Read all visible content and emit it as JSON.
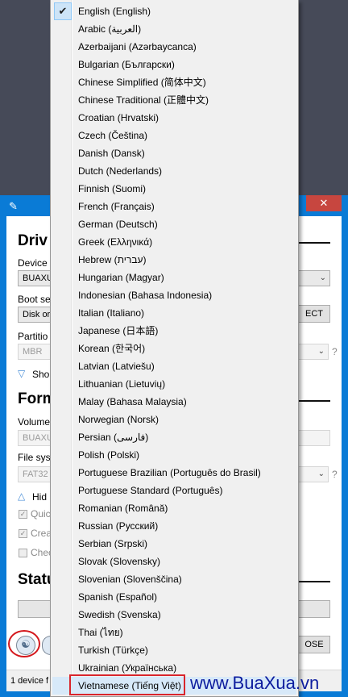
{
  "app": {
    "close_glyph": "✕",
    "drive_section_title": "Driv",
    "device_label": "Device",
    "device_value": "BUAXU",
    "boot_label": "Boot se",
    "boot_value": "Disk or",
    "select_button": "ECT",
    "partition_label": "Partitio",
    "partition_value": "MBR",
    "help_mark": "?",
    "show_advanced": "Sho",
    "format_section_title": "Form",
    "volume_label": "Volume",
    "volume_value": "BUAXU",
    "filesystem_label": "File syst",
    "filesystem_value": "FAT32",
    "hide_advanced": "Hid",
    "quick_format": "Quic",
    "create_extended": "Crea",
    "check_bad_blocks": "Chec",
    "status_section_title": "Statu",
    "close_button": "OSE",
    "status_text": "1 device f"
  },
  "menu": {
    "items": [
      {
        "label": "English (English)",
        "checked": true
      },
      {
        "label": "Arabic (العربية)"
      },
      {
        "label": "Azerbaijani (Azərbaycanca)"
      },
      {
        "label": "Bulgarian (Български)"
      },
      {
        "label": "Chinese Simplified (简体中文)"
      },
      {
        "label": "Chinese Traditional (正體中文)"
      },
      {
        "label": "Croatian (Hrvatski)"
      },
      {
        "label": "Czech (Čeština)"
      },
      {
        "label": "Danish (Dansk)"
      },
      {
        "label": "Dutch (Nederlands)"
      },
      {
        "label": "Finnish (Suomi)"
      },
      {
        "label": "French (Français)"
      },
      {
        "label": "German (Deutsch)"
      },
      {
        "label": "Greek (Ελληνικά)"
      },
      {
        "label": "Hebrew (עברית)"
      },
      {
        "label": "Hungarian (Magyar)"
      },
      {
        "label": "Indonesian (Bahasa Indonesia)"
      },
      {
        "label": "Italian (Italiano)"
      },
      {
        "label": "Japanese (日本語)"
      },
      {
        "label": "Korean (한국어)"
      },
      {
        "label": "Latvian (Latviešu)"
      },
      {
        "label": "Lithuanian (Lietuvių)"
      },
      {
        "label": "Malay (Bahasa Malaysia)"
      },
      {
        "label": "Norwegian (Norsk)"
      },
      {
        "label": "Persian (فارسی)"
      },
      {
        "label": "Polish (Polski)"
      },
      {
        "label": "Portuguese Brazilian (Português do Brasil)"
      },
      {
        "label": "Portuguese Standard (Português)"
      },
      {
        "label": "Romanian (Română)"
      },
      {
        "label": "Russian (Русский)"
      },
      {
        "label": "Serbian (Srpski)"
      },
      {
        "label": "Slovak (Slovensky)"
      },
      {
        "label": "Slovenian (Slovenščina)"
      },
      {
        "label": "Spanish (Español)"
      },
      {
        "label": "Swedish (Svenska)"
      },
      {
        "label": "Thai (ไทย)"
      },
      {
        "label": "Turkish (Türkçe)"
      },
      {
        "label": "Ukrainian (Українська)"
      },
      {
        "label": "Vietnamese (Tiếng Việt)",
        "highlighted": true
      }
    ]
  },
  "watermark": "www.BuaXua.vn",
  "colors": {
    "desktop": "#464a58",
    "window_frame": "#0a7bd6",
    "close_button": "#c7463f",
    "annotation_red": "#d9252c",
    "watermark": "#0c1c9e"
  }
}
